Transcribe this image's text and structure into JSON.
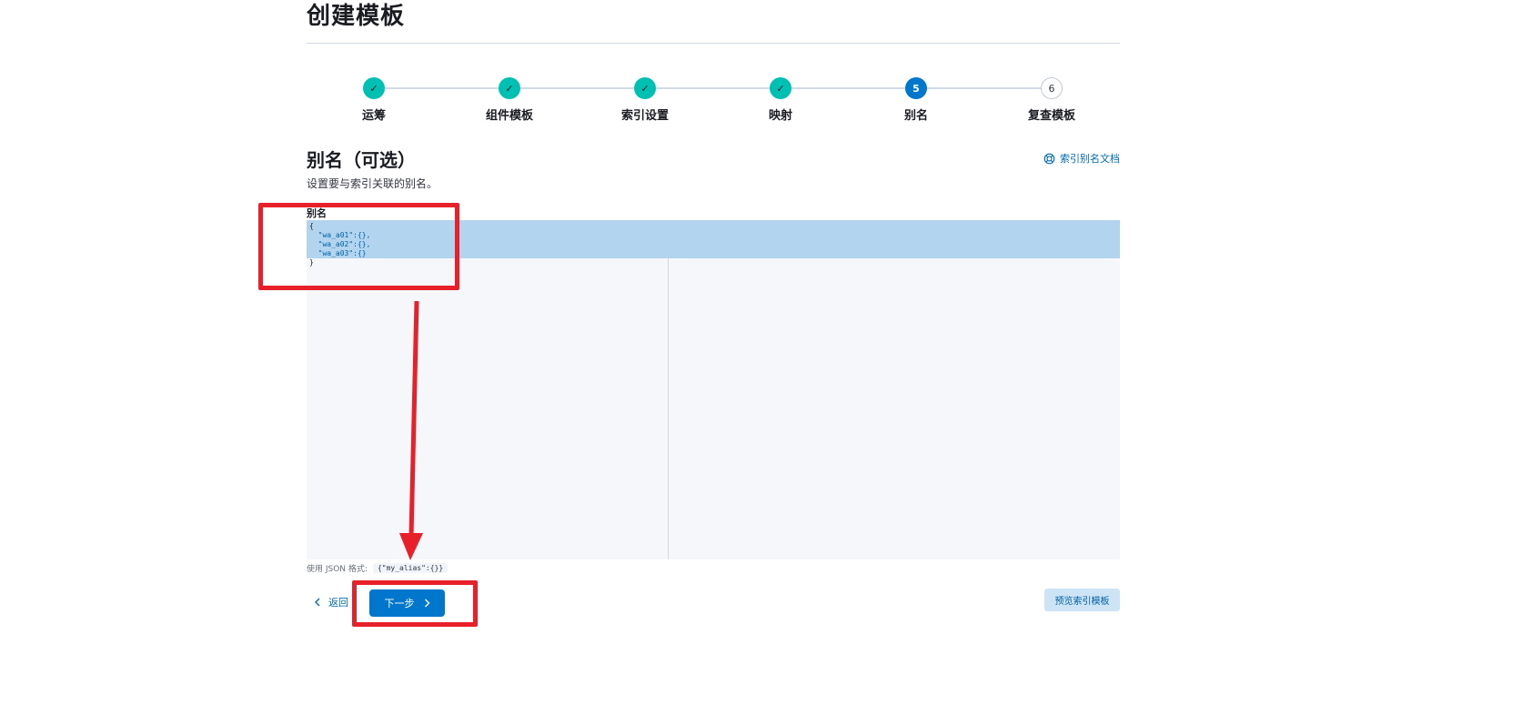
{
  "page": {
    "title": "创建模板"
  },
  "stepper": {
    "steps": [
      {
        "label": "运筹",
        "state": "done",
        "marker": "✓"
      },
      {
        "label": "组件模板",
        "state": "done",
        "marker": "✓"
      },
      {
        "label": "索引设置",
        "state": "done",
        "marker": "✓"
      },
      {
        "label": "映射",
        "state": "done",
        "marker": "✓"
      },
      {
        "label": "别名",
        "state": "current",
        "marker": "5"
      },
      {
        "label": "复查模板",
        "state": "todo",
        "marker": "6"
      }
    ]
  },
  "section": {
    "title": "别名（可选）",
    "description": "设置要与索引关联的别名。",
    "docs_link": "索引别名文档",
    "docs_icon": "lifebuoy-icon"
  },
  "editor": {
    "label": "别名",
    "lines": [
      "{",
      "  \"wa_a01\":{},",
      "  \"wa_a02\":{},",
      "  \"wa_a03\":{}",
      "}"
    ]
  },
  "help": {
    "text": "使用 JSON 格式:",
    "example": "{\"my_alias\":{}}"
  },
  "actions": {
    "back_label": "返回",
    "back_icon": "chevron-left-icon",
    "next_label": "下一步",
    "next_icon": "chevron-right-icon",
    "preview_label": "预览索引模板"
  },
  "annotation": {
    "color": "#e8202a"
  },
  "colors": {
    "step_done": "#00bfb3",
    "step_current": "#0077cc",
    "primary": "#0077cc",
    "link": "#006bb8",
    "editor_highlight": "#b3d4ee"
  }
}
